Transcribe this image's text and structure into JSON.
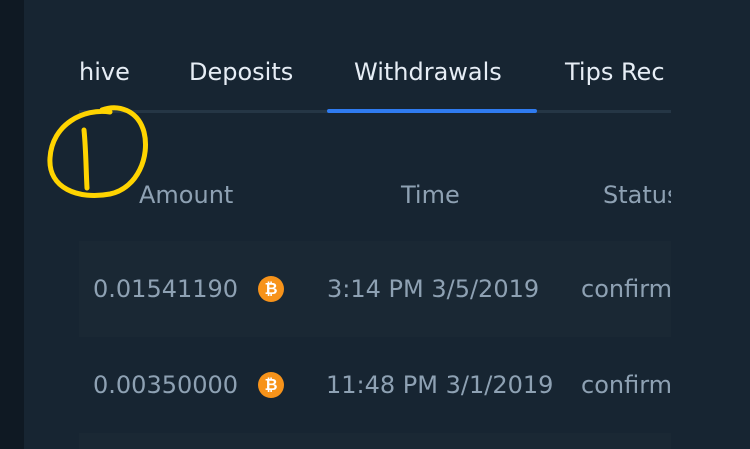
{
  "tabs": [
    {
      "label": "hive"
    },
    {
      "label": "Deposits"
    },
    {
      "label": "Withdrawals"
    },
    {
      "label": "Tips Rec"
    }
  ],
  "table": {
    "headers": [
      "Amount",
      "Time",
      "Status"
    ],
    "rows": [
      {
        "amount": "0.01541190",
        "currency_icon": "bitcoin-icon",
        "time": "3:14 PM 3/5/2019",
        "status": "confirm"
      },
      {
        "amount": "0.00350000",
        "currency_icon": "bitcoin-icon",
        "time": "11:48 PM 3/1/2019",
        "status": "confirm"
      }
    ]
  },
  "icons": {
    "bitcoin_symbol": "₿"
  },
  "colors": {
    "background": "#14202b",
    "panel": "#172532",
    "accent": "#2f7bf0",
    "bitcoin": "#f7931a",
    "annotation": "#ffd400"
  }
}
